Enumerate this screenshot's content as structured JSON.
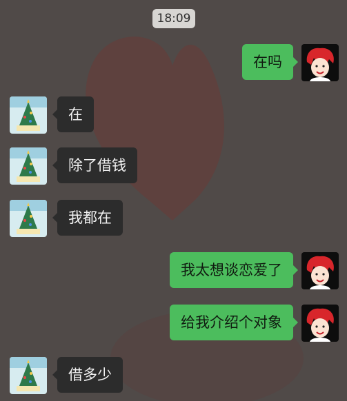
{
  "chat": {
    "timestamp": "18:09",
    "messages": [
      {
        "side": "out",
        "text": "在吗"
      },
      {
        "side": "in",
        "text": "在"
      },
      {
        "side": "in",
        "text": "除了借钱"
      },
      {
        "side": "in",
        "text": "我都在"
      },
      {
        "side": "out",
        "text": "我太想谈恋爱了"
      },
      {
        "side": "out",
        "text": "给我介绍个对象"
      },
      {
        "side": "in",
        "text": "借多少"
      }
    ]
  },
  "colors": {
    "background": "#504a48",
    "incoming_bubble": "#2c2c2c",
    "outgoing_bubble": "#4cbd5d",
    "timestamp_pill": "#d8d6d3"
  },
  "icons": {
    "incoming_avatar": "christmas-tree-avatar-icon",
    "outgoing_avatar": "red-hair-cartoon-girl-avatar-icon"
  }
}
